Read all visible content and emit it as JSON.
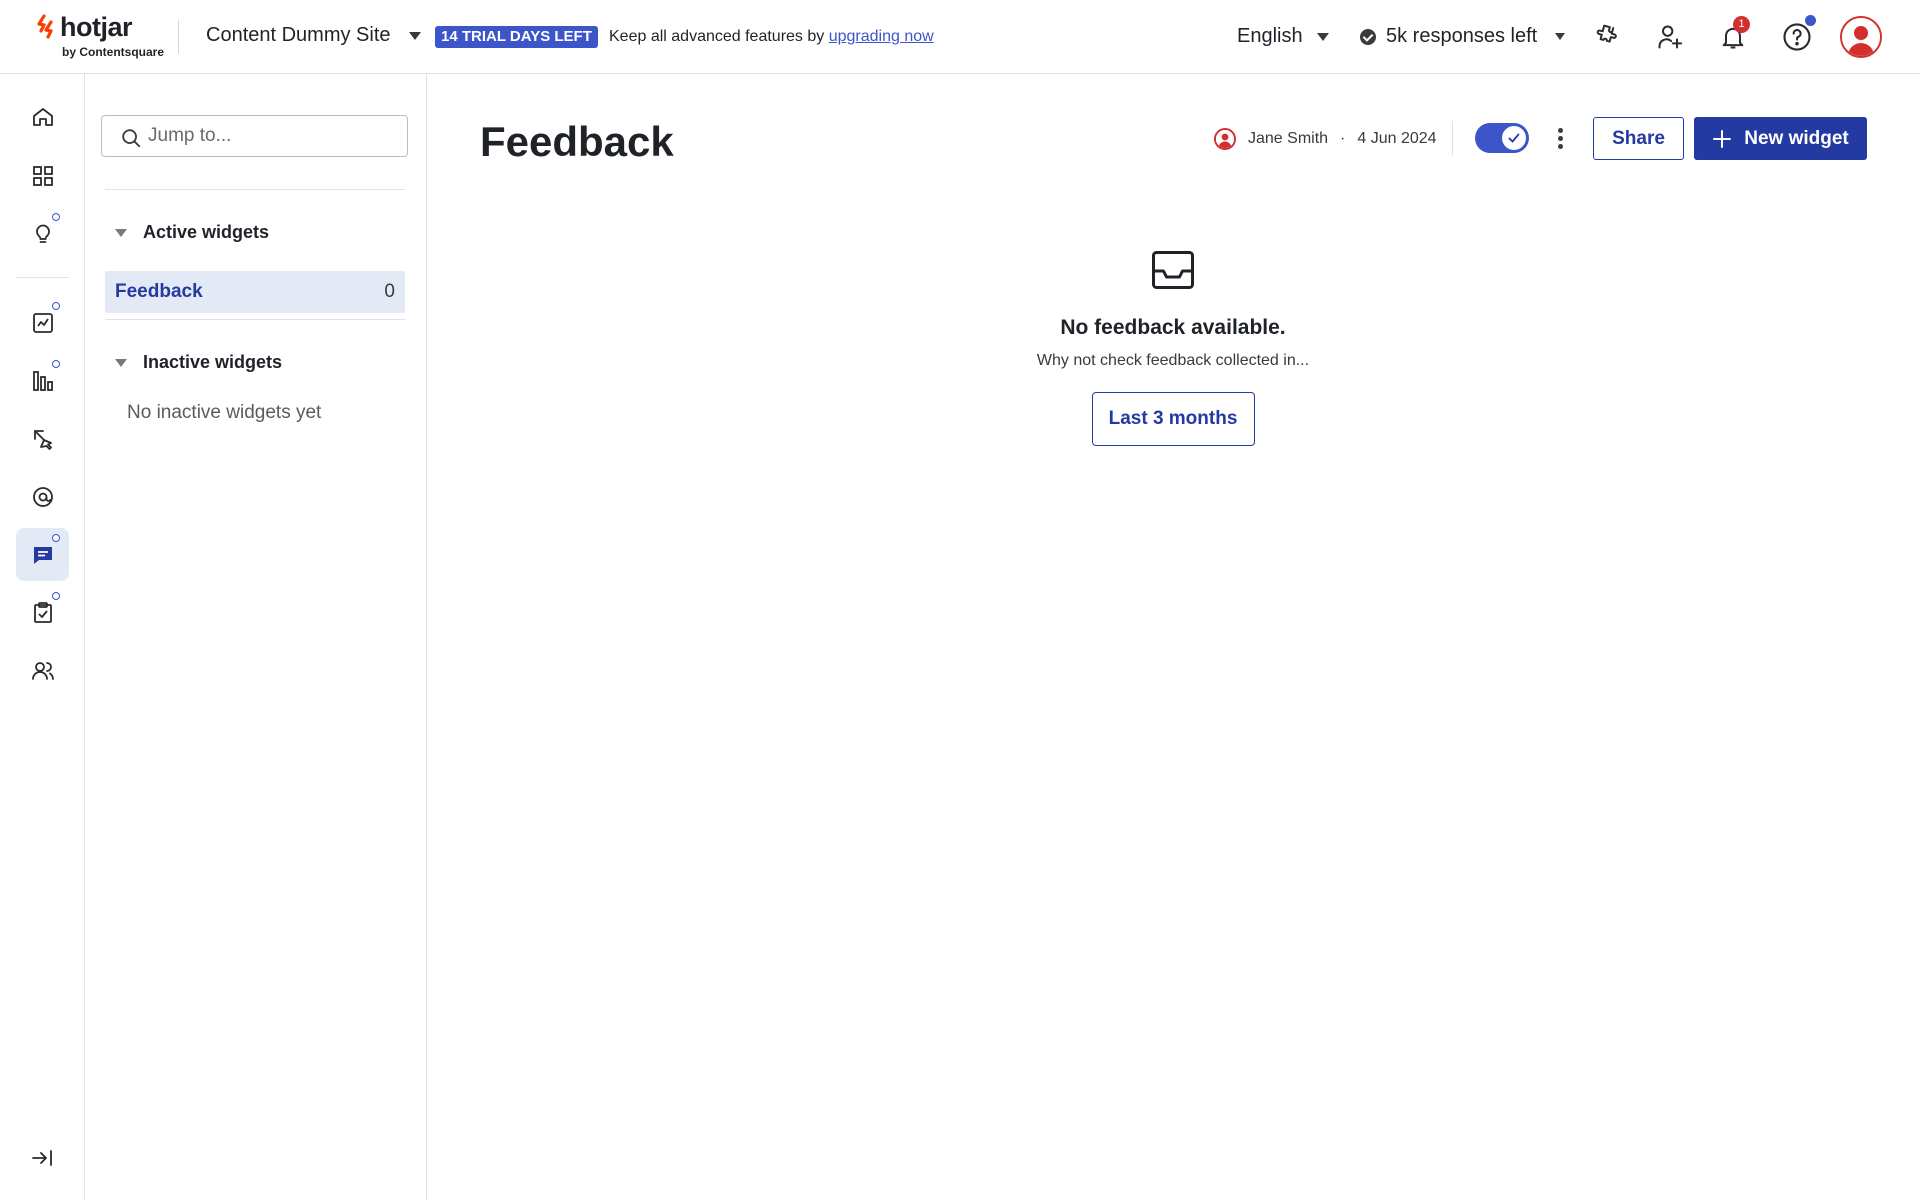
{
  "brand": {
    "name": "hotjar",
    "sub": "by Contentsquare",
    "accent": "#ff3c00"
  },
  "header": {
    "site_name": "Content Dummy Site",
    "trial_badge": "14 TRIAL DAYS LEFT",
    "trial_text": "Keep all advanced features by",
    "trial_link": "upgrading now",
    "language": "English",
    "responses": "5k responses left",
    "notification_count": "1",
    "icons": [
      "integrations-icon",
      "invite-user-icon",
      "bell-icon",
      "help-icon",
      "avatar"
    ]
  },
  "rail": {
    "items": [
      {
        "name": "home-icon"
      },
      {
        "name": "dashboard-icon"
      },
      {
        "name": "insights-icon",
        "dot": true
      },
      {
        "name": "trends-icon",
        "dot": true
      },
      {
        "name": "funnels-icon",
        "dot": true
      },
      {
        "name": "recordings-icon"
      },
      {
        "name": "engage-icon"
      },
      {
        "name": "feedback-icon",
        "dot": true,
        "active": true
      },
      {
        "name": "surveys-icon",
        "dot": true
      },
      {
        "name": "users-icon"
      }
    ],
    "collapse": "collapse-icon"
  },
  "sidebar": {
    "search_placeholder": "Jump to...",
    "active_group": "Active widgets",
    "active_items": [
      {
        "label": "Feedback",
        "count": "0"
      }
    ],
    "inactive_group": "Inactive widgets",
    "inactive_empty": "No inactive widgets yet"
  },
  "main": {
    "title": "Feedback",
    "owner": "Jane Smith",
    "separator": "·",
    "date": "4 Jun 2024",
    "toggle_on": true,
    "share_label": "Share",
    "new_widget_label": "New widget",
    "empty_title": "No feedback available.",
    "empty_sub": "Why not check feedback collected in...",
    "range_button": "Last 3 months"
  },
  "colors": {
    "primary": "#243aa3",
    "badge": "#3c55c9",
    "active_bg": "#e4e9f6",
    "alert": "#d32f2f"
  }
}
